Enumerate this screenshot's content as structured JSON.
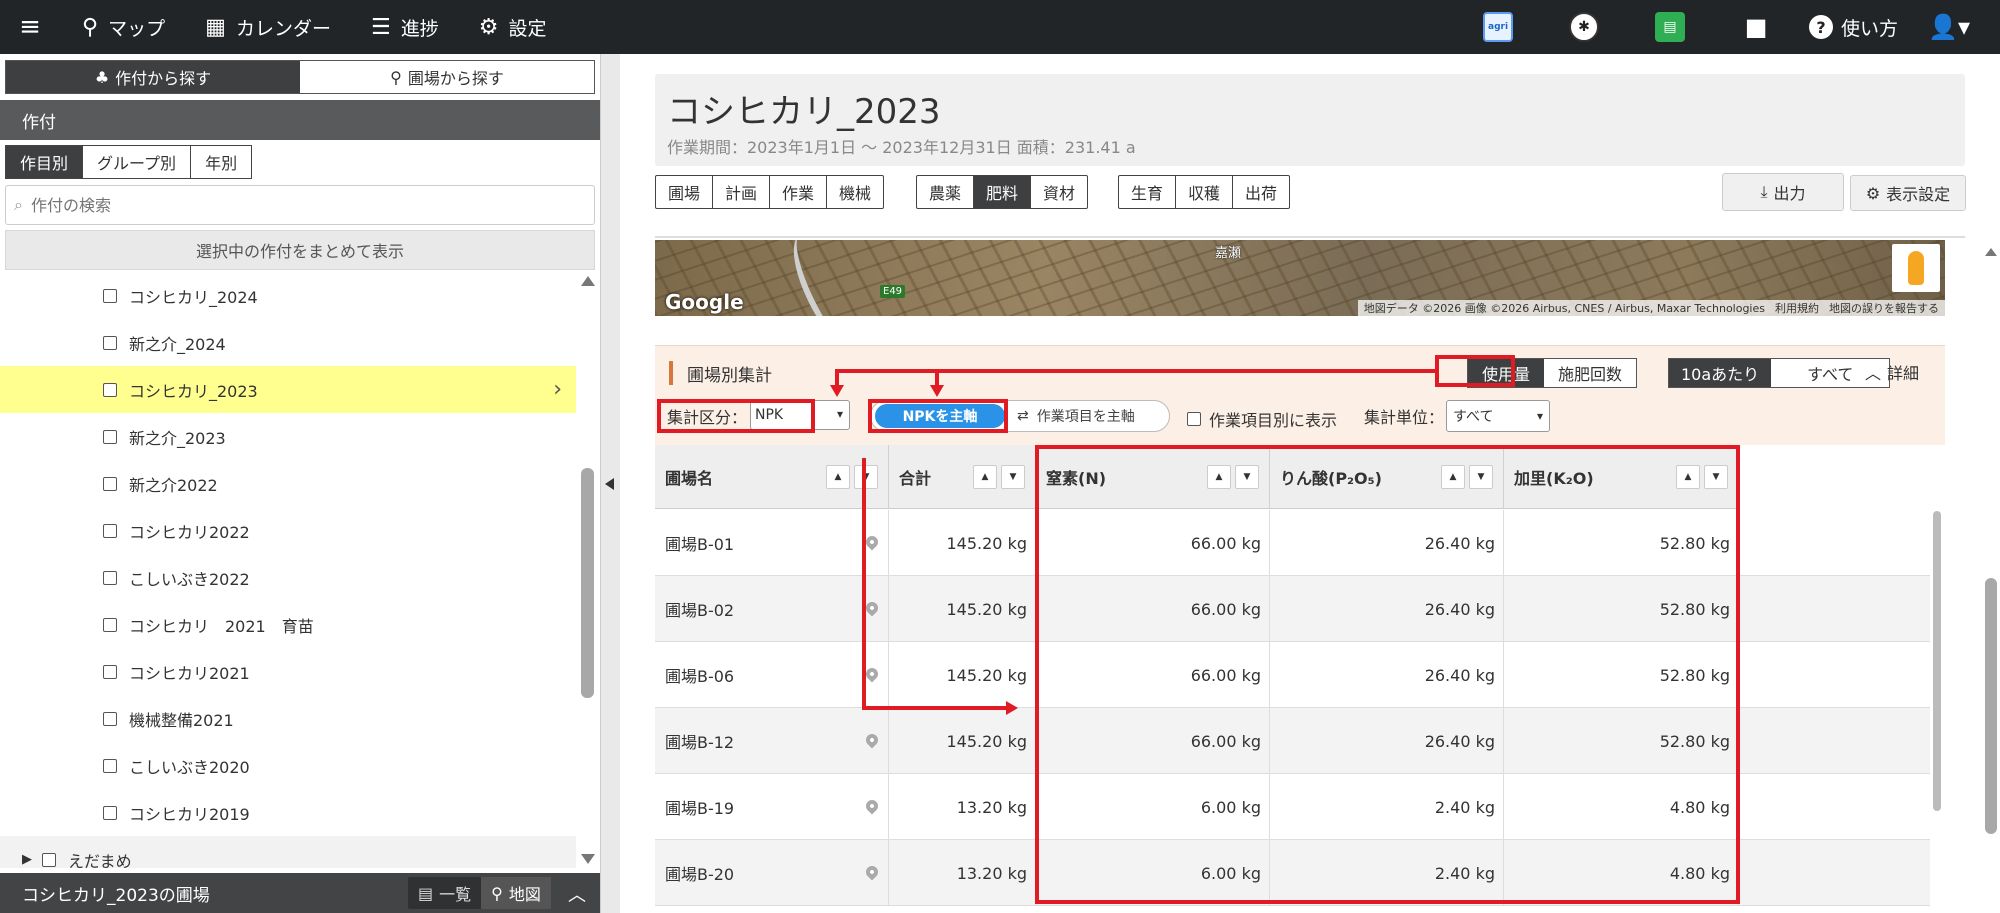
{
  "nav": {
    "map": "マップ",
    "calendar": "カレンダー",
    "progress": "進捗",
    "settings": "設定",
    "app1_label": "agri",
    "help": "使い方"
  },
  "left": {
    "tab_crop": "作付から探す",
    "tab_field": "圃場から探す",
    "section": "作付",
    "seg_bycrop": "作目別",
    "seg_bygroup": "グループ別",
    "seg_byyear": "年別",
    "search_placeholder": "作付の検索",
    "group_button": "選択中の作付をまとめて表示",
    "items": [
      "コシヒカリ_2024",
      "新之介_2024",
      "コシヒカリ_2023",
      "新之介_2023",
      "新之介2022",
      "コシヒカリ2022",
      "こしいぶき2022",
      "コシヒカリ　2021　育苗",
      "コシヒカリ2021",
      "機械整備2021",
      "こしいぶき2020",
      "コシヒカリ2019"
    ],
    "group_item": "えだまめ",
    "footer_title": "コシヒカリ_2023の圃場",
    "footer_list": "一覧",
    "footer_map": "地図"
  },
  "header": {
    "title": "コシヒカリ_2023",
    "period": "作業期間：2023年1月1日 ～ 2023年12月31日  面積：231.41 a",
    "tabs1": [
      "圃場",
      "計画",
      "作業",
      "機械"
    ],
    "tabs2": [
      "農薬",
      "肥料",
      "資材"
    ],
    "tabs3": [
      "生育",
      "収穫",
      "出荷"
    ],
    "export": "出力",
    "display_settings": "表示設定"
  },
  "map": {
    "google": "Google",
    "road_sign": "E49",
    "place": "嘉瀬",
    "attribution": "地図データ ©2026 画像 ©2026 Airbus, CNES / Airbus, Maxar Technologies",
    "terms": "利用規約",
    "report": "地図の誤りを報告する"
  },
  "summary": {
    "title": "圃場別集計",
    "usage": "使用量",
    "times": "施肥回数",
    "per10a": "10aあたり",
    "all": "すべて",
    "detail": "詳細",
    "agg_label": "集計区分：",
    "agg_value": "NPK",
    "npk_main": "NPKを主軸",
    "work_main": "作業項目を主軸",
    "by_work": "作業項目別に表示",
    "unit_label": "集計単位：",
    "unit_value": "すべて"
  },
  "table": {
    "headers": [
      "圃場名",
      "合計",
      "窒素(N)",
      "りん酸(P₂O₅)",
      "加里(K₂O)"
    ],
    "rows": [
      [
        "圃場B-01",
        "145.20 kg",
        "66.00 kg",
        "26.40 kg",
        "52.80 kg"
      ],
      [
        "圃場B-02",
        "145.20 kg",
        "66.00 kg",
        "26.40 kg",
        "52.80 kg"
      ],
      [
        "圃場B-06",
        "145.20 kg",
        "66.00 kg",
        "26.40 kg",
        "52.80 kg"
      ],
      [
        "圃場B-12",
        "145.20 kg",
        "66.00 kg",
        "26.40 kg",
        "52.80 kg"
      ],
      [
        "圃場B-19",
        "13.20 kg",
        "6.00 kg",
        "2.40 kg",
        "4.80 kg"
      ],
      [
        "圃場B-20",
        "13.20 kg",
        "6.00 kg",
        "2.40 kg",
        "4.80 kg"
      ]
    ]
  },
  "colors": {
    "nav_bg": "#222527",
    "accent_blue": "#2b93e7",
    "annotation_red": "#e01b24",
    "highlight_yellow": "#ffff8f",
    "summary_bg": "#fcefe6"
  }
}
